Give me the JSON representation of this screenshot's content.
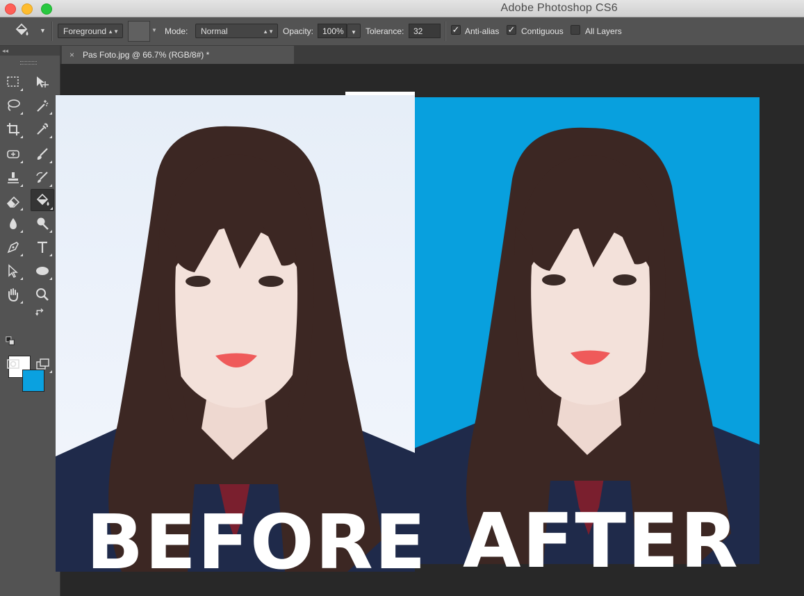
{
  "app": {
    "title": "Adobe Photoshop CS6"
  },
  "options": {
    "fill_source": "Foreground",
    "mode_label": "Mode:",
    "mode_value": "Normal",
    "opacity_label": "Opacity:",
    "opacity_value": "100%",
    "tolerance_label": "Tolerance:",
    "tolerance_value": "32",
    "anti_alias_label": "Anti-alias",
    "anti_alias_checked": true,
    "contiguous_label": "Contiguous",
    "contiguous_checked": true,
    "all_layers_label": "All Layers",
    "all_layers_checked": false
  },
  "toolbox": {
    "collapse": "◂◂",
    "foreground_color": "#ffffff",
    "background_color": "#0aa1e0",
    "active_tool": "paint-bucket"
  },
  "document": {
    "tab_close": "×",
    "tab_title": "Pas Foto.jpg @ 66.7% (RGB/8#) *"
  },
  "canvas": {
    "before_label": "BEFORE",
    "after_label": "AFTER",
    "before_bg": "#eef3fb",
    "after_bg": "#08a0de"
  }
}
